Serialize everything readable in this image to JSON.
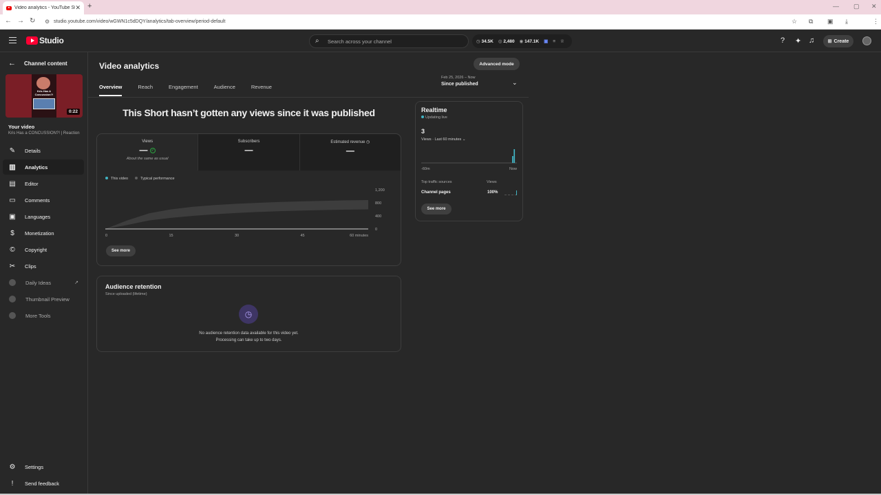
{
  "browser": {
    "tab_title": "Video analytics - YouTube Studio",
    "url": "studio.youtube.com/video/wGWN1c5dDQY/analytics/tab-overview/period-default"
  },
  "header": {
    "logo_text": "Studio",
    "search_placeholder": "Search across your channel",
    "stats": [
      "34.5K",
      "2,480",
      "147.1K"
    ],
    "create_label": "Create"
  },
  "sidebar": {
    "back_label": "Channel content",
    "thumb_caption": "Kris Has A Concussion?!",
    "thumb_duration": "0:22",
    "your_video_label": "Your video",
    "video_title": "Kris Has a CONCUSSION?! | Reaction",
    "items": [
      {
        "label": "Details"
      },
      {
        "label": "Analytics"
      },
      {
        "label": "Editor"
      },
      {
        "label": "Comments"
      },
      {
        "label": "Languages"
      },
      {
        "label": "Monetization"
      },
      {
        "label": "Copyright"
      },
      {
        "label": "Clips"
      },
      {
        "label": "Daily Ideas"
      },
      {
        "label": "Thumbnail Preview"
      },
      {
        "label": "More Tools"
      }
    ],
    "settings_label": "Settings",
    "feedback_label": "Send feedback"
  },
  "main": {
    "title": "Video analytics",
    "advanced_mode_label": "Advanced mode",
    "tabs": [
      "Overview",
      "Reach",
      "Engagement",
      "Audience",
      "Revenue"
    ],
    "period_sub": "Feb 25, 2026 – Now",
    "period_main": "Since published",
    "headline": "This Short hasn’t gotten any views since it was published"
  },
  "metrics": [
    {
      "label": "Views",
      "value": "—",
      "note": "About the same as usual"
    },
    {
      "label": "Subscribers",
      "value": "—"
    },
    {
      "label": "Estimated revenue",
      "value": "—"
    }
  ],
  "chart_data": {
    "type": "area",
    "series": [
      {
        "name": "This video",
        "color": "#41b4c4"
      },
      {
        "name": "Typical performance",
        "color": "#606060"
      }
    ],
    "x": [
      0,
      15,
      30,
      45,
      60
    ],
    "x_tick_labels": [
      "0",
      "15",
      "30",
      "45",
      "60 minutes"
    ],
    "y_ticks": [
      "1,200",
      "800",
      "400",
      "0"
    ],
    "ylim": [
      0,
      1200
    ],
    "typical_band": {
      "x": [
        0,
        5,
        10,
        15,
        20,
        25,
        30,
        35,
        40,
        45,
        50,
        55,
        60
      ],
      "low": [
        0,
        120,
        260,
        340,
        400,
        450,
        490,
        520,
        545,
        565,
        580,
        592,
        600
      ],
      "high": [
        0,
        260,
        480,
        600,
        680,
        730,
        770,
        800,
        825,
        845,
        860,
        875,
        885
      ]
    },
    "see_more_label": "See more"
  },
  "retention": {
    "title": "Audience retention",
    "subtitle": "Since uploaded (lifetime)",
    "message_line1": "No audience retention data available for this video yet.",
    "message_line2": "Processing can take up to two days."
  },
  "realtime": {
    "title": "Realtime",
    "status": "Updating live",
    "count": "3",
    "views_label": "Views · Last 60 minutes",
    "axis_left": "-60m",
    "axis_right": "Now",
    "minute_bars": [
      0,
      0,
      0,
      0,
      0,
      0,
      0,
      0,
      0,
      0,
      0,
      0,
      0,
      0,
      0,
      0,
      0,
      0,
      0,
      0,
      0,
      0,
      0,
      0,
      0,
      0,
      0,
      0,
      0,
      0,
      0,
      0,
      0,
      0,
      0,
      0,
      0,
      0,
      0,
      0,
      0,
      0,
      0,
      0,
      0,
      0,
      0,
      0,
      0,
      0,
      0,
      0,
      0,
      0,
      0,
      0,
      0,
      1,
      2,
      0
    ],
    "sources_header": "Top traffic sources",
    "views_header": "Views",
    "source_name": "Channel pages",
    "source_pct": "100%",
    "see_more_label": "See more"
  }
}
